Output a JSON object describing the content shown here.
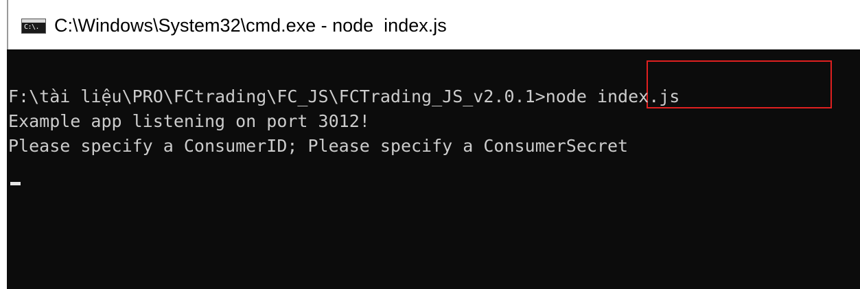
{
  "window": {
    "title": "C:\\Windows\\System32\\cmd.exe - node  index.js",
    "icon_name": "cmd-icon",
    "icon_text": "C:\\."
  },
  "console": {
    "background": "#0c0c0c",
    "text_color": "#cccccc",
    "prompt_path": "F:\\tài liệu\\PRO\\FCtrading\\FC_JS\\FCTrading_JS_v2.0.1",
    "prompt_char": ">",
    "command": "node index.js",
    "output_lines": [
      "Example app listening on port 3012!",
      "Please specify a ConsumerID; Please specify a ConsumerSecret"
    ],
    "highlight_color": "#e02020"
  }
}
